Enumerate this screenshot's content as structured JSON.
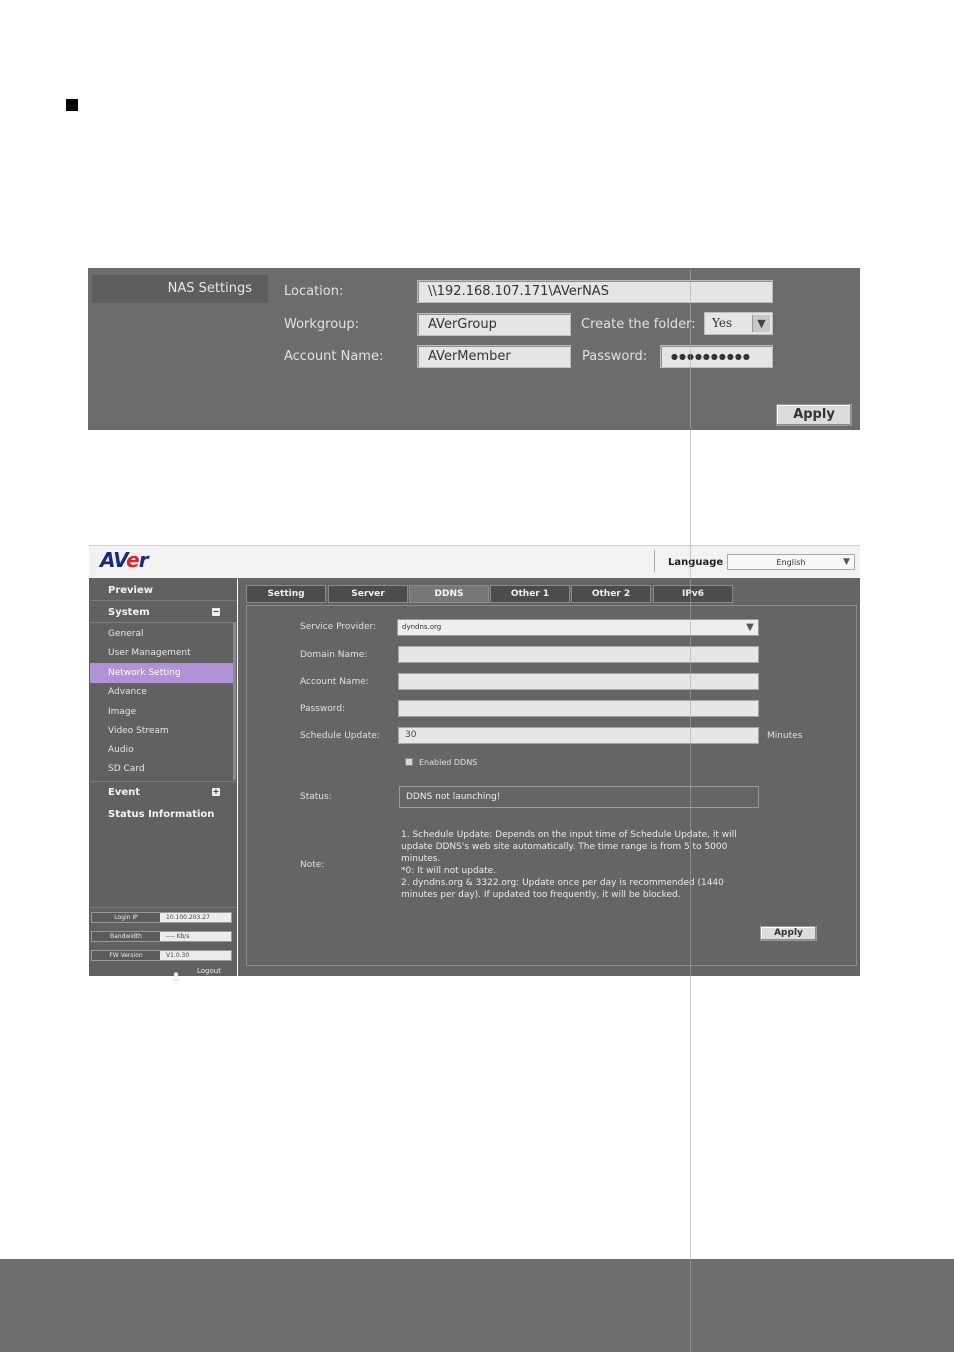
{
  "nas": {
    "header": "NAS Settings",
    "location_label": "Location:",
    "location_value": "\\\\192.168.107.171\\AVerNAS",
    "workgroup_label": "Workgroup:",
    "workgroup_value": "AVerGroup",
    "create_folder_label": "Create the folder:",
    "create_folder_value": "Yes",
    "account_label": "Account Name:",
    "account_value": "AVerMember",
    "password_label": "Password:",
    "password_value": "●●●●●●●●●●",
    "apply_label": "Apply"
  },
  "aver": {
    "logo_a": "AV",
    "logo_e": "e",
    "logo_r": "r",
    "language_label": "Language",
    "language_value": "English",
    "sidebar": {
      "preview": "Preview",
      "system": "System",
      "system_toggle": "−",
      "items": [
        "General",
        "User Management",
        "Network Setting",
        "Advance",
        "Image",
        "Video Stream",
        "Audio",
        "SD Card"
      ],
      "event": "Event",
      "event_toggle": "+",
      "status_info": "Status Information",
      "login_ip_label": "Login IP",
      "login_ip_value": "10.100.203.27",
      "bandwidth_label": "Bandwidth",
      "bandwidth_value": "---- Kb/s",
      "fw_label": "FW Version",
      "fw_value": "V1.0.30",
      "logout": "Logout"
    },
    "tabs": [
      "Setting",
      "Server",
      "DDNS",
      "Other 1",
      "Other 2",
      "IPv6"
    ],
    "active_tab": "DDNS",
    "form": {
      "service_provider_label": "Service Provider:",
      "service_provider_value": "dyndns.org",
      "domain_label": "Domain Name:",
      "domain_value": "",
      "account_label": "Account Name:",
      "account_value": "",
      "password_label": "Password:",
      "password_value": "",
      "schedule_label": "Schedule Update:",
      "schedule_value": "30",
      "minutes_label": "Minutes",
      "enable_label": "Enabled DDNS",
      "status_label": "Status:",
      "status_value": "DDNS not launching!",
      "note_label": "Note:",
      "note_text": "1. Schedule Update: Depends on the input time of Schedule Update, it will update DDNS's web site automatically. The time range is from 5 to 5000 minutes.\n*0: It will not update.\n2. dyndns.org & 3322.org: Update once per day is recommended (1440 minutes per day). If updated too frequently, it will be blocked.",
      "apply_label": "Apply"
    }
  }
}
